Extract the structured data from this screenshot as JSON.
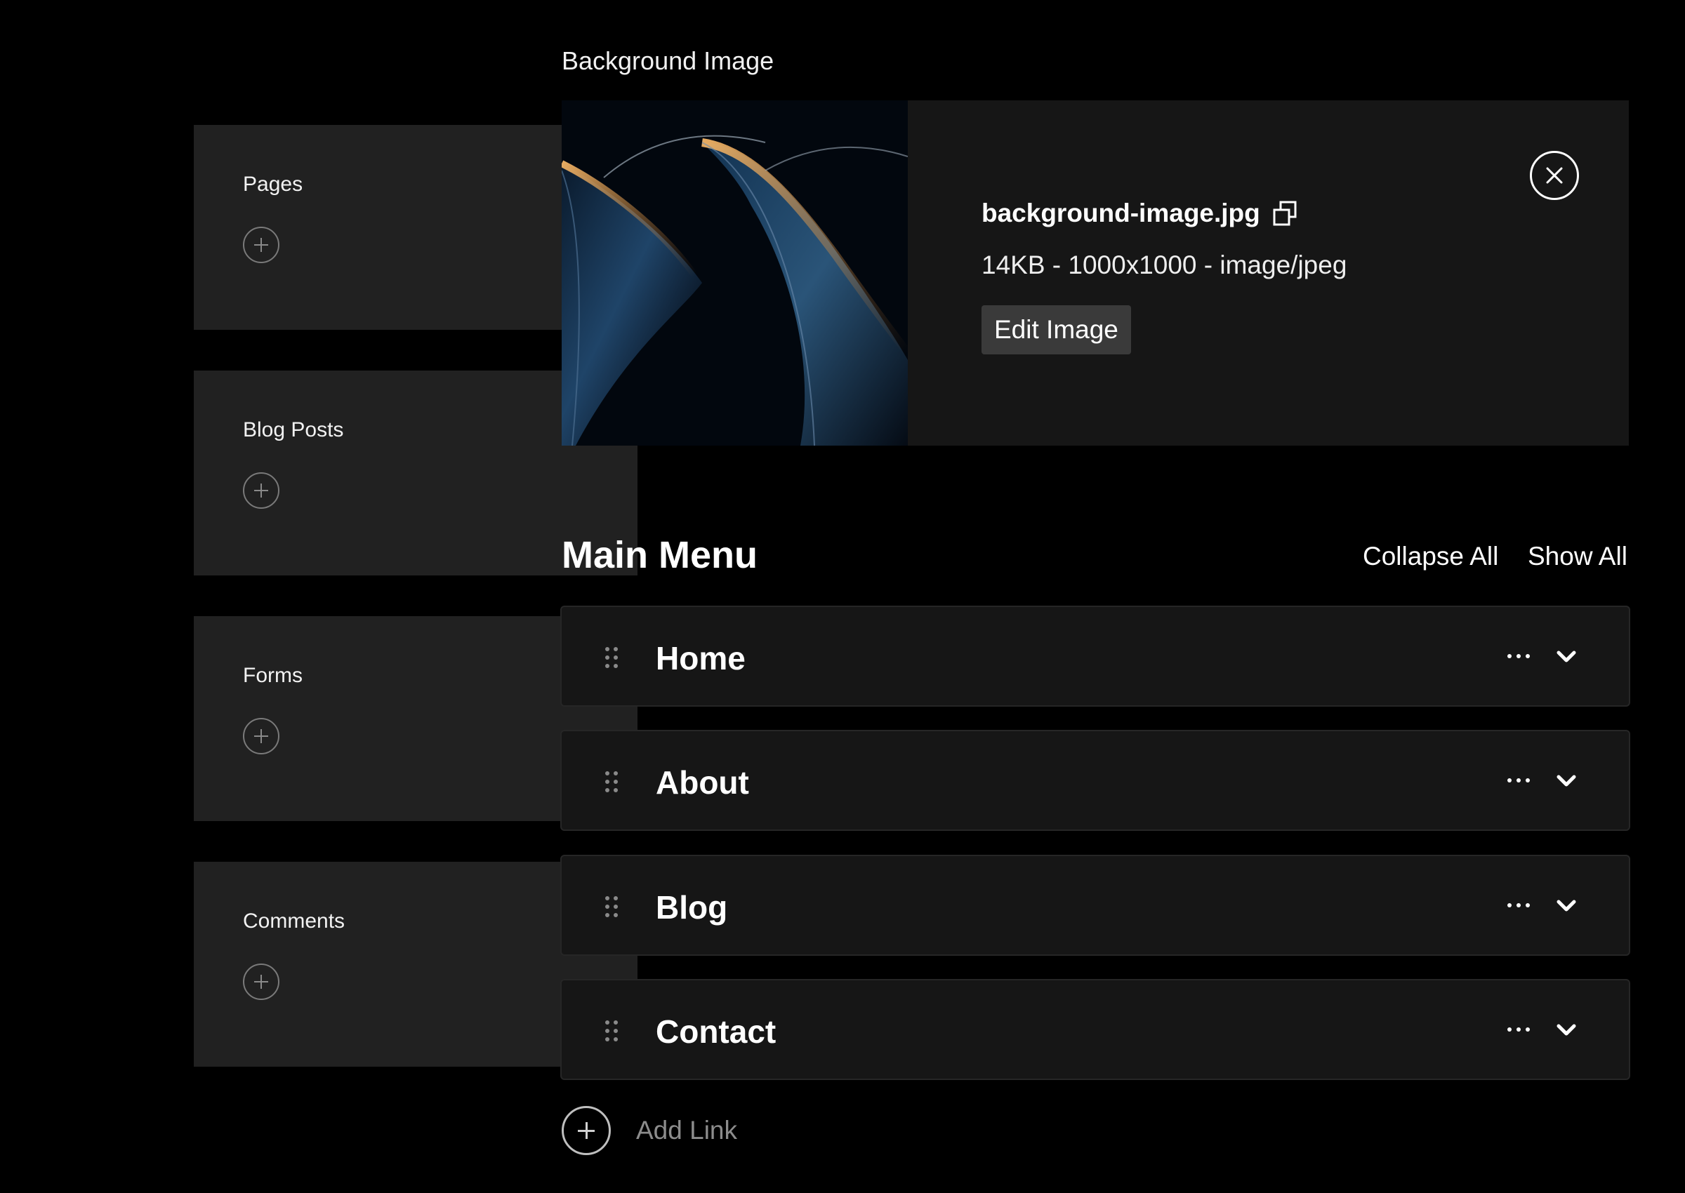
{
  "sidebar": {
    "panels": [
      {
        "title": "Pages"
      },
      {
        "title": "Blog Posts"
      },
      {
        "title": "Forms"
      },
      {
        "title": "Comments"
      }
    ]
  },
  "background_image": {
    "section_label": "Background Image",
    "file_name": "background-image.jpg",
    "meta": "14KB - 1000x1000 - image/jpeg",
    "edit_label": "Edit Image",
    "icons": {
      "copy": "copy-icon",
      "close": "close-icon"
    }
  },
  "main_menu": {
    "title": "Main Menu",
    "collapse_label": "Collapse All",
    "show_label": "Show All",
    "items": [
      {
        "label": "Home"
      },
      {
        "label": "About"
      },
      {
        "label": "Blog"
      },
      {
        "label": "Contact"
      }
    ],
    "add_link_label": "Add Link"
  },
  "colors": {
    "background": "#000000",
    "panel": "#212121",
    "card": "#161616",
    "button": "#3a3a3a",
    "thumb_highlight": "#f0a44a",
    "thumb_body": "#1d3b5c"
  }
}
